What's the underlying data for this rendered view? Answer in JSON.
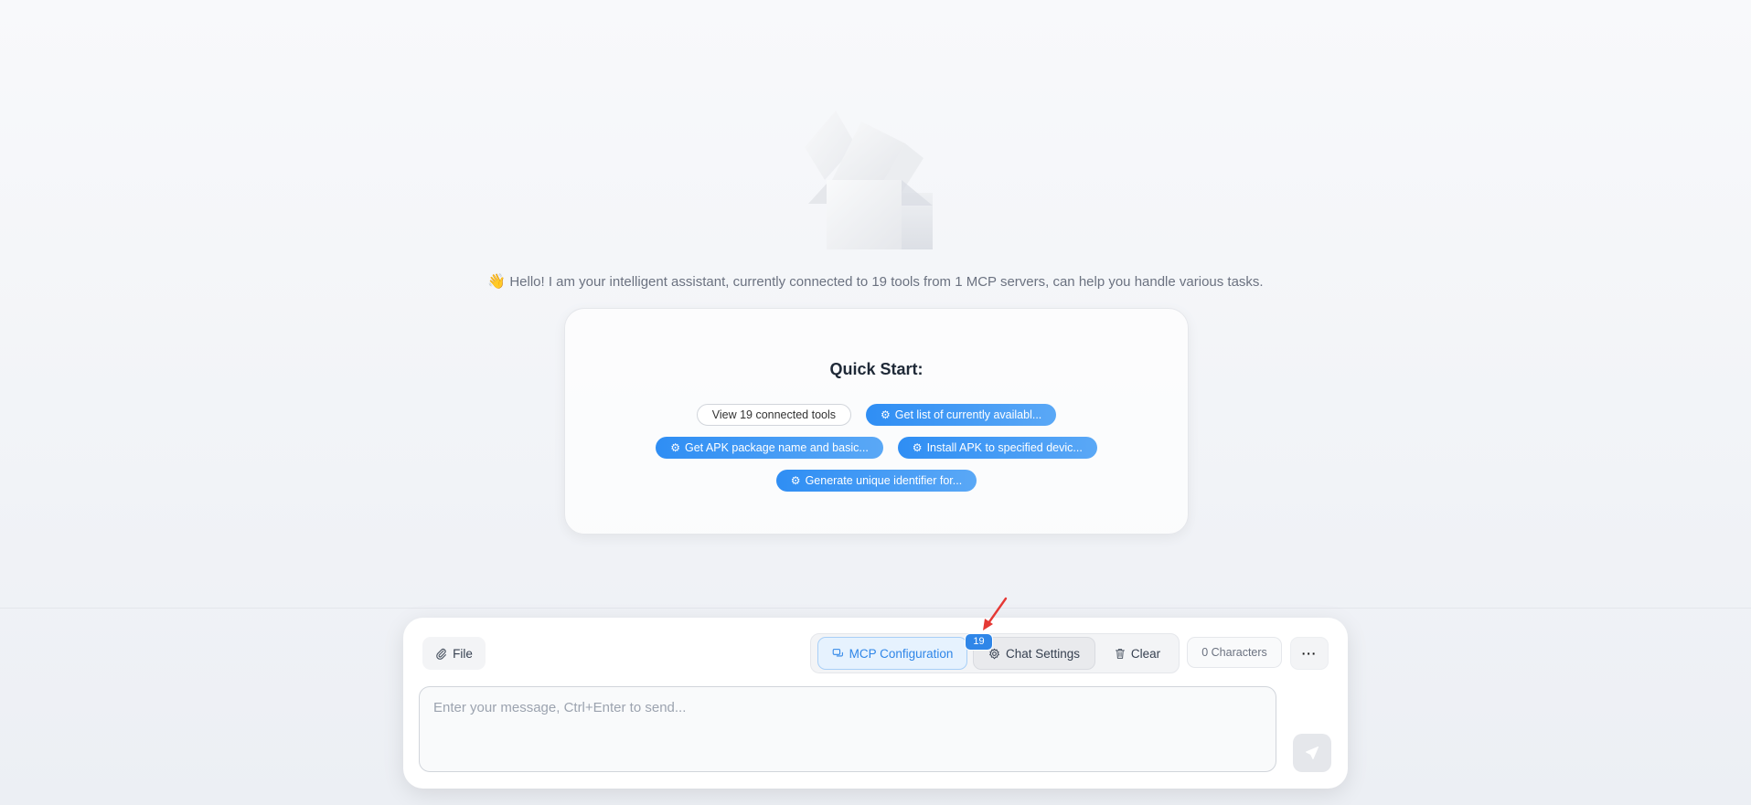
{
  "welcome": {
    "emoji": "👋",
    "text": "Hello! I am your intelligent assistant, currently connected to 19 tools from 1 MCP servers, can help you handle various tasks."
  },
  "quick_start": {
    "title": "Quick Start:",
    "view_tools": "View 19 connected tools",
    "suggestions": [
      "Get list of currently availabl...",
      "Get APK package name and basic...",
      "Install APK to specified devic...",
      "Generate unique identifier for..."
    ]
  },
  "toolbar": {
    "file_label": "File",
    "mcp_label": "MCP Configuration",
    "mcp_badge": "19",
    "chat_settings_label": "Chat Settings",
    "clear_label": "Clear",
    "char_count": "0 Characters",
    "more_label": "···"
  },
  "composer": {
    "placeholder": "Enter your message, Ctrl+Enter to send..."
  },
  "icons": {
    "file": "paperclip-icon",
    "mcp": "chat-bubbles-icon",
    "chat_settings": "gear-icon",
    "clear": "trash-icon",
    "send": "send-icon",
    "suggestion": "cog-icon"
  },
  "colors": {
    "accent": "#2f86e8",
    "annotation_arrow": "#e53935"
  }
}
